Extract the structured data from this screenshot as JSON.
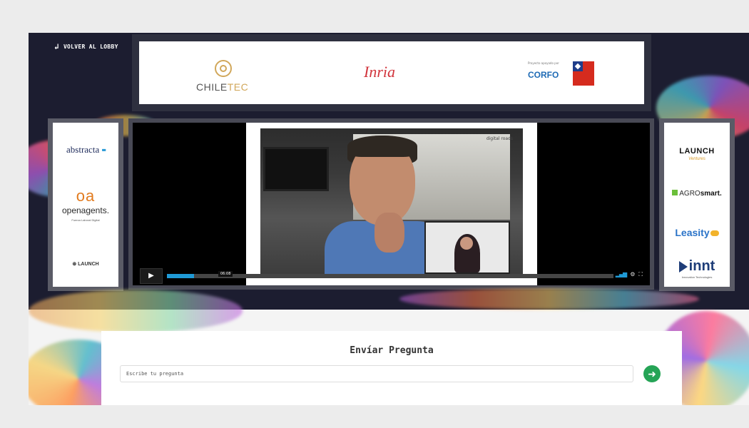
{
  "nav": {
    "back_label": "VOLVER AL LOBBY",
    "back_icon": "return-arrow-icon"
  },
  "top_banner": {
    "chiletec": {
      "main": "CHILE",
      "accent": "TEC"
    },
    "inria": "Inria",
    "corfo_tagline": "Proyecto apoyado por",
    "corfo": "CORFO",
    "gov_badge": "chile-government-logo"
  },
  "left_sponsors": {
    "abstracta": "abstracta",
    "openagents_mark": "oa",
    "openagents": "openagents.",
    "openagents_sub": "Fuerza Laboral Digital",
    "launch": "LAUNCH"
  },
  "right_sponsors": {
    "launch": "LAUNCH",
    "launch_sub": "Ventures",
    "agrosmart_a": "AGRO",
    "agrosmart_b": "smart.",
    "leasity": "Leasity",
    "innt": "innt",
    "innt_sub": "Innovation Technologies"
  },
  "video": {
    "overlay_brand": "digital roads",
    "current_time": "06:08",
    "progress": 0.06,
    "play_icon": "play-icon",
    "volume_icon": "volume-icon",
    "settings_icon": "gear-icon",
    "fullscreen_icon": "fullscreen-icon"
  },
  "question": {
    "title": "Envíar Pregunta",
    "placeholder": "Escribe tu pregunta",
    "send_icon": "arrow-right-icon"
  },
  "colors": {
    "accent_green": "#25a456",
    "progress_blue": "#1f9ad6",
    "stage_bg": "#1c1d30"
  }
}
